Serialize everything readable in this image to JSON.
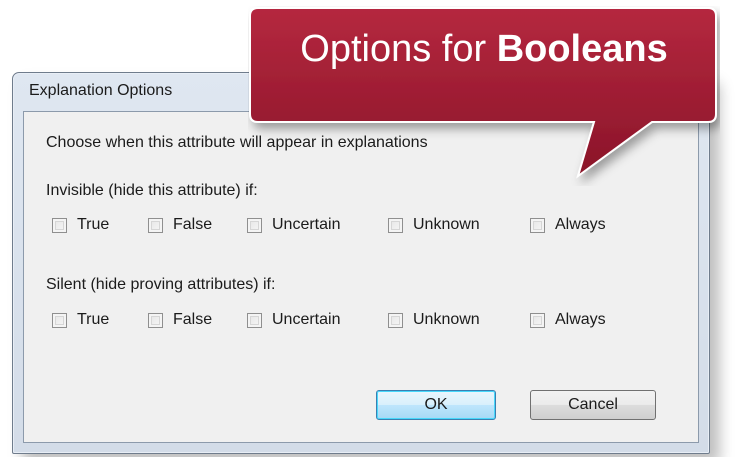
{
  "window": {
    "title": "Explanation Options"
  },
  "dialog": {
    "instruction": "Choose when this attribute will appear in explanations",
    "invisible": {
      "label": "Invisible (hide this attribute) if:",
      "options": [
        "True",
        "False",
        "Uncertain",
        "Unknown",
        "Always"
      ],
      "checked": [
        false,
        false,
        false,
        false,
        false
      ]
    },
    "silent": {
      "label": "Silent (hide proving attributes) if:",
      "options": [
        "True",
        "False",
        "Uncertain",
        "Unknown",
        "Always"
      ],
      "checked": [
        false,
        false,
        false,
        false,
        false
      ]
    },
    "buttons": {
      "ok": "OK",
      "cancel": "Cancel"
    }
  },
  "callout": {
    "text_prefix": "Options for ",
    "text_bold": "Booleans",
    "color": "#9e1b32"
  }
}
